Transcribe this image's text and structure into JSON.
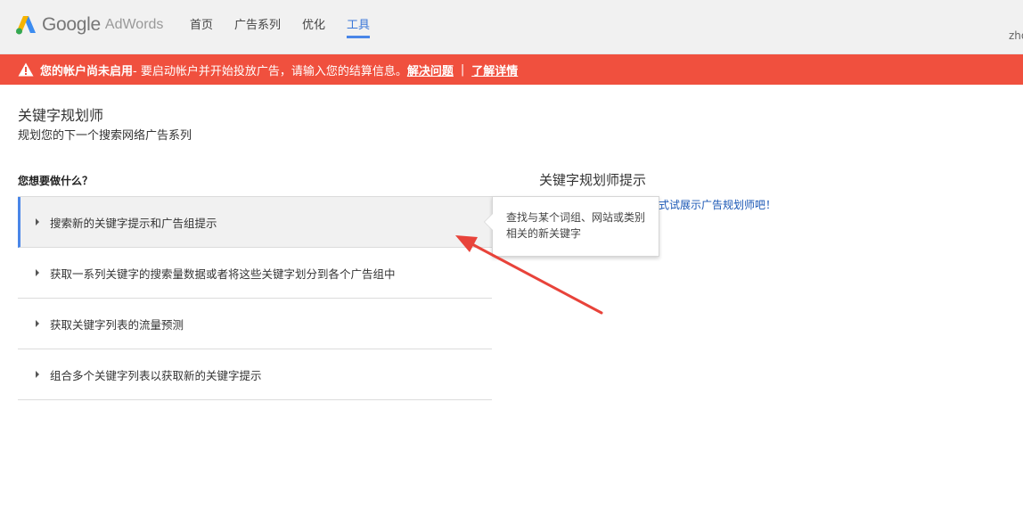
{
  "header": {
    "logo_google": "Google",
    "logo_product": "AdWords",
    "nav": [
      {
        "label": "首页"
      },
      {
        "label": "广告系列"
      },
      {
        "label": "优化"
      },
      {
        "label": "工具",
        "active": true
      }
    ],
    "user": "zho"
  },
  "alert": {
    "strong": "您的帐户尚未启用",
    "message": " - 要启动帐户并开始投放广告，请输入您的结算信息。",
    "link1": "解决问题",
    "separator": "|",
    "link2": "了解详情",
    "icon": "warning-icon",
    "color": "#f0503e"
  },
  "page": {
    "title": "关键字规划师",
    "subtitle": "规划您的下一个搜索网络广告系列"
  },
  "main": {
    "question": "您想要做什么？",
    "options": [
      {
        "label": "搜索新的关键字提示和广告组提示",
        "active": true
      },
      {
        "label": "获取一系列关键字的搜索量数据或者将这些关键字划分到各个广告组中"
      },
      {
        "label": "获取关键字列表的流量预测"
      },
      {
        "label": "组合多个关键字列表以获取新的关键字提示"
      }
    ],
    "tooltip": "查找与某个词组、网站或类别相关的新关键字"
  },
  "tips": {
    "title": "关键字规划师提示",
    "link": "式试展示广告规划师吧！"
  },
  "colors": {
    "accent": "#4a86e8",
    "annotation_arrow": "#e8433a"
  }
}
